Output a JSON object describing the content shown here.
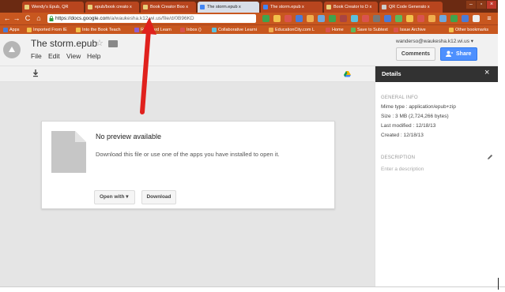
{
  "browser": {
    "tabs": [
      {
        "label": "Wendy's Epub, QR",
        "active": false
      },
      {
        "label": "epub/book creato x",
        "active": false
      },
      {
        "label": "Book Creator Boo x",
        "active": false
      },
      {
        "label": "The storm.epub x",
        "active": true
      },
      {
        "label": "The storm.epub x",
        "active": false
      },
      {
        "label": "Book Creator to D x",
        "active": false
      },
      {
        "label": "QR Code Generato x",
        "active": false
      }
    ],
    "url_prefix": "https://docs.google.com",
    "url_rest": "/a/waukesha.k12.wi.us/file/d/0B96KD",
    "bookmarks": [
      {
        "label": "Apps",
        "color": "#4b7bd6"
      },
      {
        "label": "Imported From IE",
        "color": "#f2c14b"
      },
      {
        "label": "Into the Book Teach",
        "color": "#f2c14b"
      },
      {
        "label": "Rd Board Learn",
        "color": "#8f5fd1"
      },
      {
        "label": "Inbox ()",
        "color": "#d9534f"
      },
      {
        "label": "Collaborative Learni",
        "color": "#5bc0de"
      },
      {
        "label": "EducationCity.com L",
        "color": "#f0ad4e"
      },
      {
        "label": "Home",
        "color": "#d9534f"
      },
      {
        "label": "Save to Subtext",
        "color": "#5cb85c"
      },
      {
        "label": "Issue Archive",
        "color": "#d9534f"
      },
      {
        "label": "Other bookmarks",
        "color": "#f2c14b"
      }
    ],
    "colors": {
      "chrome": "#c8571f",
      "tabstrip": "#6b2a12",
      "annotation": "#e0211d"
    }
  },
  "docs": {
    "title": "The storm.epub",
    "menu": [
      "File",
      "Edit",
      "View",
      "Help"
    ],
    "account": "wanderso@waukesha.k12.wi.us",
    "comments_label": "Comments",
    "share_label": "Share"
  },
  "preview": {
    "title": "No preview available",
    "message": "Download this file or use one of the apps you have installed to open it.",
    "open_with_label": "Open with",
    "download_label": "Download"
  },
  "details": {
    "title": "Details",
    "general_heading": "GENERAL INFO",
    "mime": "Mime type : application/epub+zip",
    "size": "Size : 3 MB (2,724,266 bytes)",
    "modified": "Last modified : 12/18/13",
    "created": "Created : 12/18/13",
    "description_heading": "DESCRIPTION",
    "description_placeholder": "Enter a description"
  }
}
